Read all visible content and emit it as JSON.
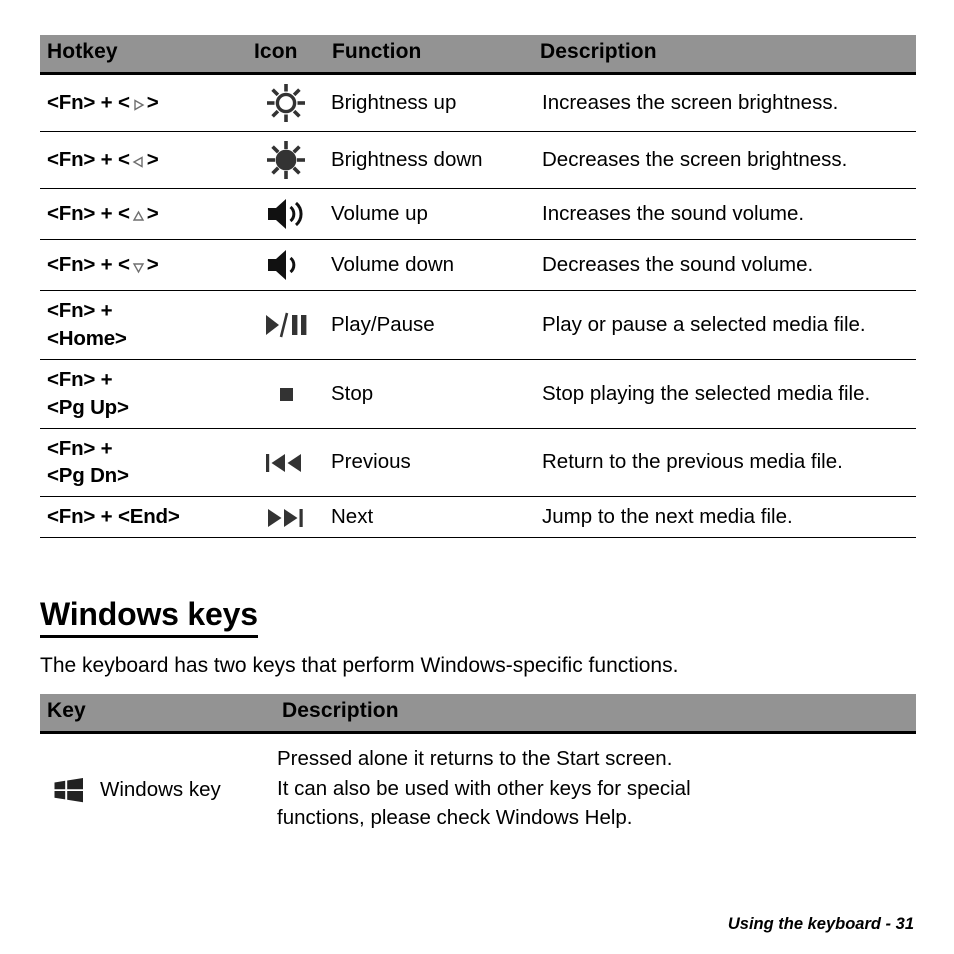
{
  "document": {
    "footer": "Using the keyboard -  31",
    "section_heading": "Windows keys",
    "intro_paragraph": "The keyboard has two keys that perform Windows-specific functions."
  },
  "hotkey_table": {
    "headers": {
      "hotkey": "Hotkey",
      "icon": "Icon",
      "function": "Function",
      "description": "Description"
    },
    "rows": [
      {
        "hotkey_prefix": "<Fn> + <",
        "hotkey_suffix": ">",
        "hotkey_arrow": "right-triangle-outline",
        "hotkey_full": "<Fn> + <▷>",
        "icon": "brightness-up-icon",
        "function": "Brightness up",
        "description": "Increases the screen brightness."
      },
      {
        "hotkey_prefix": "<Fn> + <",
        "hotkey_suffix": ">",
        "hotkey_arrow": "left-triangle-outline",
        "hotkey_full": "<Fn> + <◁>",
        "icon": "brightness-down-icon",
        "function": "Brightness down",
        "description": "Decreases the screen brightness."
      },
      {
        "hotkey_prefix": "<Fn> + <",
        "hotkey_suffix": ">",
        "hotkey_arrow": "up-triangle-outline",
        "hotkey_full": "<Fn> + <△>",
        "icon": "volume-up-icon",
        "function": "Volume up",
        "description": "Increases the sound volume."
      },
      {
        "hotkey_prefix": "<Fn> + <",
        "hotkey_suffix": ">",
        "hotkey_arrow": "down-triangle-outline",
        "hotkey_full": "<Fn> + <▽>",
        "icon": "volume-down-icon",
        "function": "Volume down",
        "description": "Decreases the sound volume."
      },
      {
        "hotkey_full": "<Fn> + <Home>",
        "hotkey_line1": "<Fn> + ",
        "hotkey_line2": "<Home>",
        "icon": "play-pause-icon",
        "function": "Play/Pause",
        "description": "Play or pause a selected media file."
      },
      {
        "hotkey_full": "<Fn> + <Pg Up>",
        "hotkey_line1": "<Fn> + ",
        "hotkey_line2": "<Pg Up>",
        "icon": "stop-icon",
        "function": "Stop",
        "description": "Stop playing the selected media file."
      },
      {
        "hotkey_full": "<Fn> + <Pg Dn>",
        "hotkey_line1": "<Fn> + ",
        "hotkey_line2": "<Pg Dn>",
        "icon": "previous-track-icon",
        "function": "Previous",
        "description": "Return to the previous media file."
      },
      {
        "hotkey_full": "<Fn> + <End>",
        "hotkey_line1": "<Fn> + <End>",
        "hotkey_line2": "",
        "icon": "next-track-icon",
        "function": "Next",
        "description": "Jump to the next media file."
      }
    ]
  },
  "windows_key_table": {
    "headers": {
      "key": "Key",
      "description": "Description"
    },
    "rows": [
      {
        "icon": "windows-logo-icon",
        "key_name": "Windows key",
        "description_lines": [
          "Pressed alone it returns to the Start screen.",
          "It can also be used with other keys for special",
          "functions, please check Windows Help."
        ]
      }
    ]
  },
  "colors": {
    "header_bar": "#939393",
    "text": "#000000",
    "icon": "#333333",
    "page_background": "#ffffff"
  }
}
